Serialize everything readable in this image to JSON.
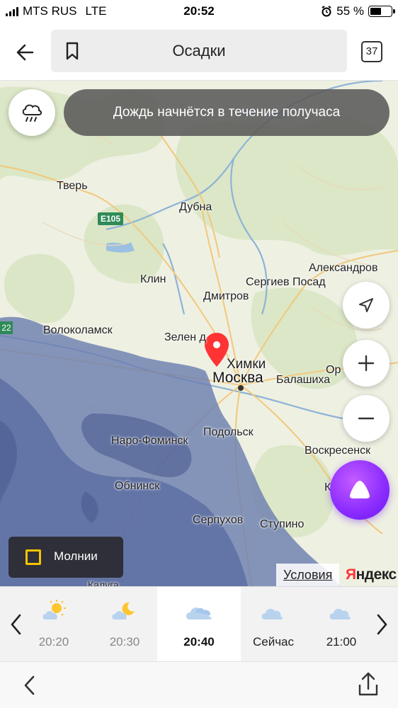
{
  "status": {
    "carrier": "MTS RUS",
    "network": "LTE",
    "time": "20:52",
    "battery": "55 %",
    "battery_level": 0.55
  },
  "toolbar": {
    "title": "Осадки",
    "tab_count": "37"
  },
  "banner": {
    "text": "Дождь начнётся в течение получаса"
  },
  "map": {
    "cities": {
      "tver": "Тверь",
      "dubna": "Дубна",
      "klin": "Клин",
      "sergiev": "Сергиев Посад",
      "dmitrov": "Дмитров",
      "alexandrov": "Александров",
      "volokolamsk": "Волоколамск",
      "zelenograd": "Зелен     д",
      "khimki": "Химки",
      "moscow": "Москва",
      "balashikha": "Балашиха",
      "orekhovo": "Ор",
      "podolsk": "Подольск",
      "naro": "Наро-Фоминск",
      "voskresensk": "Воскресенск",
      "obninsk": "Обнинск",
      "serpukhov": "Серпухов",
      "stupino": "Ступино",
      "kaluga": "Калуга",
      "k_edge": "К"
    },
    "road_label": "E105",
    "edge_label": "22",
    "lightning_label": "Молнии",
    "terms": "Условия",
    "logo_ya": "Я",
    "logo_rest": "ндекс",
    "colors": {
      "rain": "#6d7fb0",
      "rain_heavy": "#55679e",
      "accent": "#ff3333",
      "alice": "#8a2bff"
    }
  },
  "timeline": {
    "slots": [
      {
        "time": "20:20",
        "icon": "sun-cloud-icon"
      },
      {
        "time": "20:30",
        "icon": "moon-cloud-icon"
      },
      {
        "time": "20:40",
        "icon": "cloud-icon",
        "active": true
      },
      {
        "time": "Сейчас",
        "icon": "cloud-icon"
      },
      {
        "time": "21:00",
        "icon": "cloud-icon"
      }
    ]
  }
}
